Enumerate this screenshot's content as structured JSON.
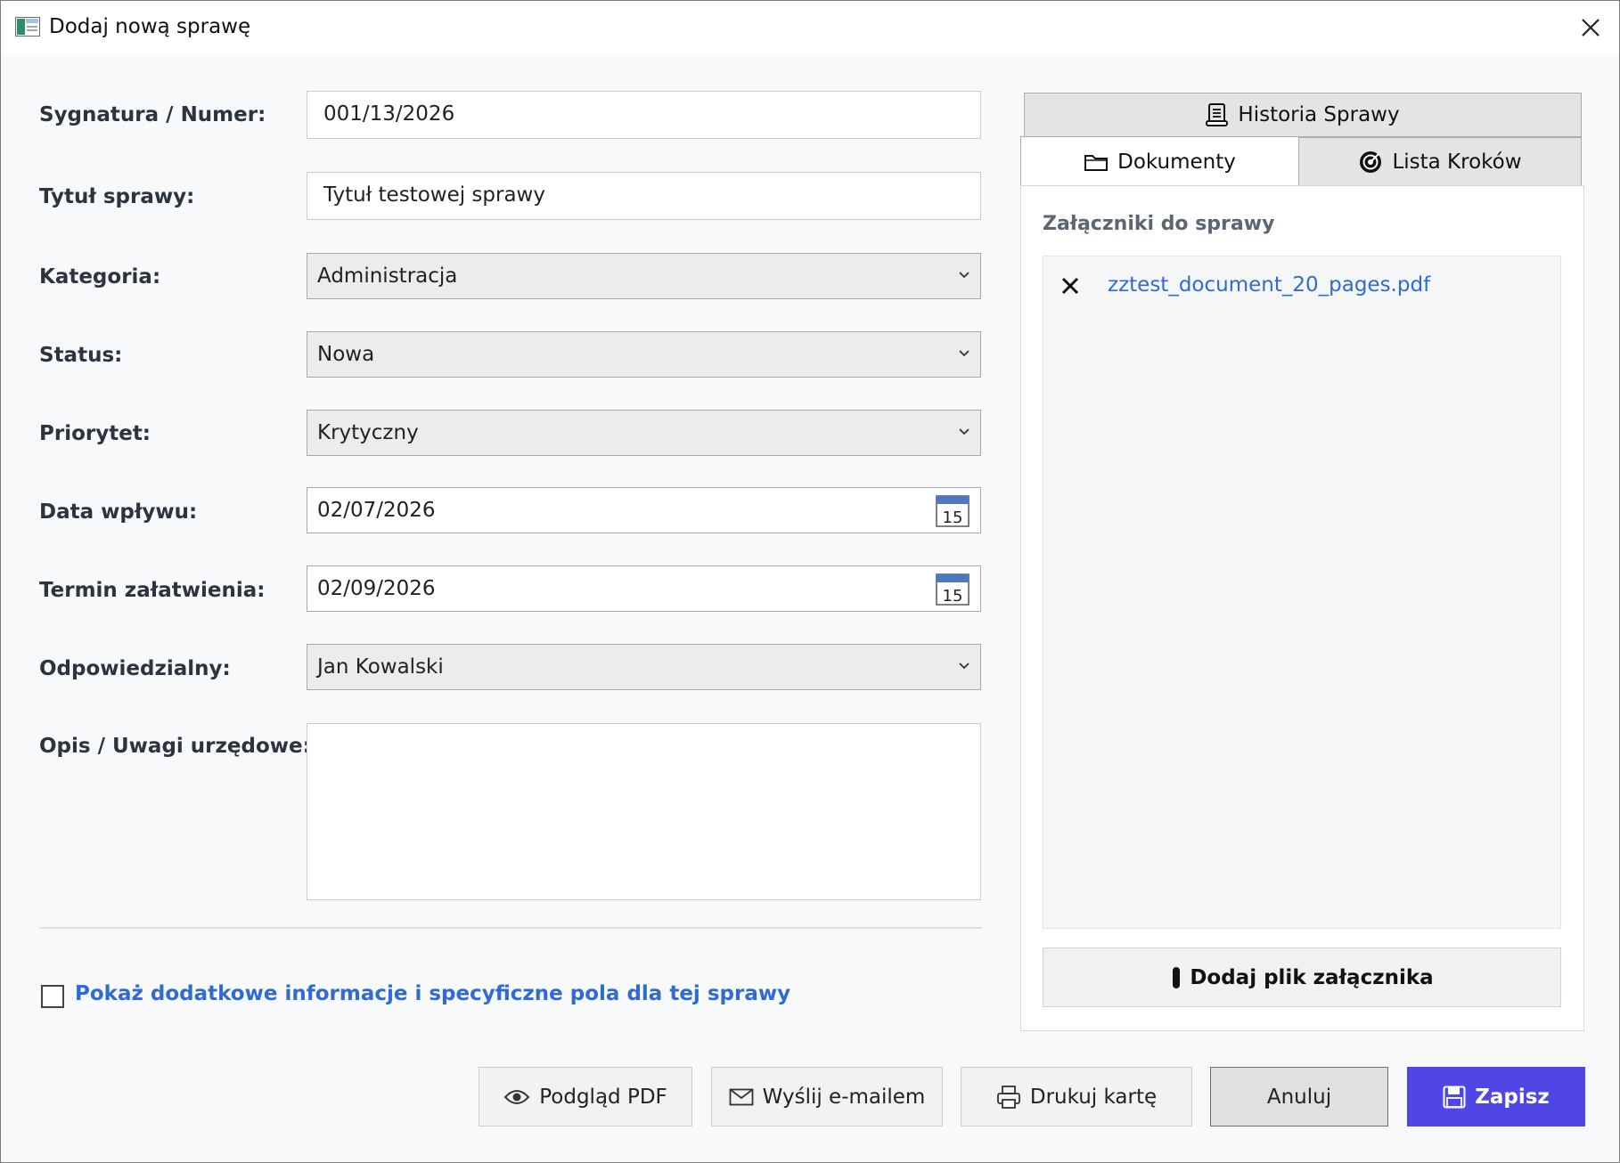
{
  "window": {
    "title": "Dodaj nową sprawę"
  },
  "form": {
    "signature_label": "Sygnatura / Numer:",
    "signature_value": "001/13/2026",
    "title_label": "Tytuł sprawy:",
    "title_value": "Tytuł testowej sprawy",
    "category_label": "Kategoria:",
    "category_value": "Administracja",
    "status_label": "Status:",
    "status_value": "Nowa",
    "priority_label": "Priorytet:",
    "priority_value": "Krytyczny",
    "received_label": "Data wpływu:",
    "received_value": "02/07/2026",
    "deadline_label": "Termin załatwienia:",
    "deadline_value": "02/09/2026",
    "responsible_label": "Odpowiedzialny:",
    "responsible_value": "Jan Kowalski",
    "description_label": "Opis / Uwagi urzędowe:",
    "description_value": "",
    "calendar_day": "15",
    "extra_checkbox_label": "Pokaż dodatkowe informacje i specyficzne pola dla tej sprawy"
  },
  "tabs": {
    "history": "Historia Sprawy",
    "documents": "Dokumenty",
    "steps": "Lista Kroków"
  },
  "attachments": {
    "title": "Załączniki do sprawy",
    "files": [
      "zztest_document_20_pages.pdf"
    ],
    "add_button": "Dodaj plik załącznika"
  },
  "buttons": {
    "preview_pdf": "Podgląd PDF",
    "send_email": "Wyślij e-mailem",
    "print_card": "Drukuj kartę",
    "cancel": "Anuluj",
    "save": "Zapisz"
  },
  "colors": {
    "accent": "#4f46e5",
    "link": "#2f6bd1",
    "label": "#2b3540"
  }
}
